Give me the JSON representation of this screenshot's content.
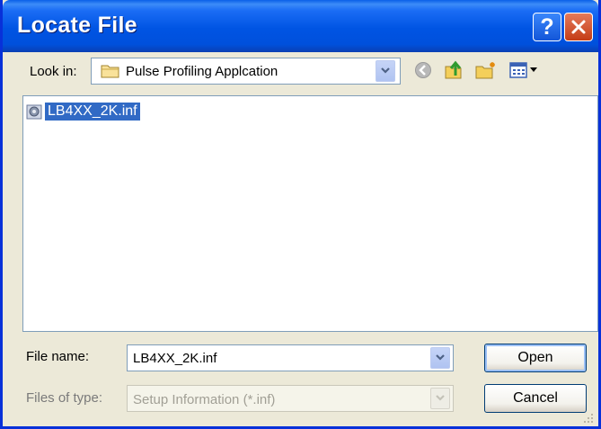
{
  "window": {
    "title": "Locate File"
  },
  "lookin": {
    "label": "Look in:",
    "value": "Pulse Profiling Applcation"
  },
  "toolbar": {
    "icons": [
      "back-icon",
      "up-folder-icon",
      "new-folder-icon",
      "view-menu-icon"
    ]
  },
  "files": [
    {
      "name": "LB4XX_2K.inf",
      "icon": "setup-file-icon",
      "selected": true
    }
  ],
  "filename": {
    "label": "File name:",
    "value": "LB4XX_2K.inf"
  },
  "filetype": {
    "label": "Files of type:",
    "value": "Setup Information (*.inf)",
    "enabled": false
  },
  "buttons": {
    "open": "Open",
    "cancel": "Cancel"
  },
  "colors": {
    "titlebar": "#0054e3",
    "selection": "#316ac5",
    "dialog_bg": "#ece9d8",
    "close_button": "#c43c16"
  }
}
